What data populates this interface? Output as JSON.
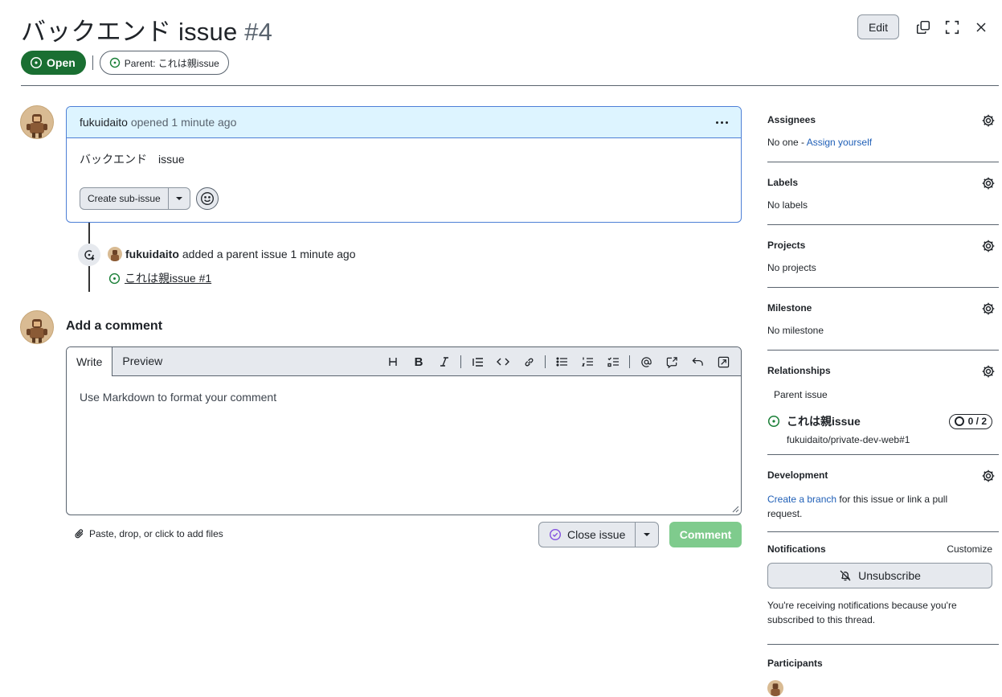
{
  "issue": {
    "title": "バックエンド issue",
    "number": "#4",
    "state": "Open",
    "parent_pill": "Parent: これは親issue"
  },
  "top_actions": {
    "edit_label": "Edit"
  },
  "comment": {
    "author": "fukuidaito",
    "meta": "opened 1 minute ago",
    "body": "バックエンド　issue",
    "sub_issue_label": "Create sub-issue"
  },
  "timeline": {
    "author": "fukuidaito",
    "action": "added a parent issue 1 minute ago",
    "link_text": "これは親issue #1"
  },
  "composer": {
    "heading": "Add a comment",
    "tab_write": "Write",
    "tab_preview": "Preview",
    "placeholder": "Use Markdown to format your comment",
    "attach_text": "Paste, drop, or click to add files",
    "close_label": "Close issue",
    "comment_label": "Comment"
  },
  "sidebar": {
    "assignees": {
      "title": "Assignees",
      "value_prefix": "No one - ",
      "value_link": "Assign yourself"
    },
    "labels": {
      "title": "Labels",
      "value": "No labels"
    },
    "projects": {
      "title": "Projects",
      "value": "No projects"
    },
    "milestone": {
      "title": "Milestone",
      "value": "No milestone"
    },
    "relationships": {
      "title": "Relationships",
      "sub_title": "Parent issue",
      "parent_title": "これは親issue",
      "parent_progress": "0 / 2",
      "parent_repo": "fukuidaito/private-dev-web#1"
    },
    "development": {
      "title": "Development",
      "link": "Create a branch",
      "rest": " for this issue or link a pull request."
    },
    "notifications": {
      "title": "Notifications",
      "customize": "Customize",
      "button": "Unsubscribe",
      "note": "You're receiving notifications because you're subscribed to this thread."
    },
    "participants": {
      "title": "Participants"
    }
  },
  "colors": {
    "open_green": "#1a6f32",
    "comment_header": "#ddf4ff",
    "comment_border": "#4d7fd6",
    "comment_button": "#7fcb8d",
    "link": "#1f5fb7"
  }
}
